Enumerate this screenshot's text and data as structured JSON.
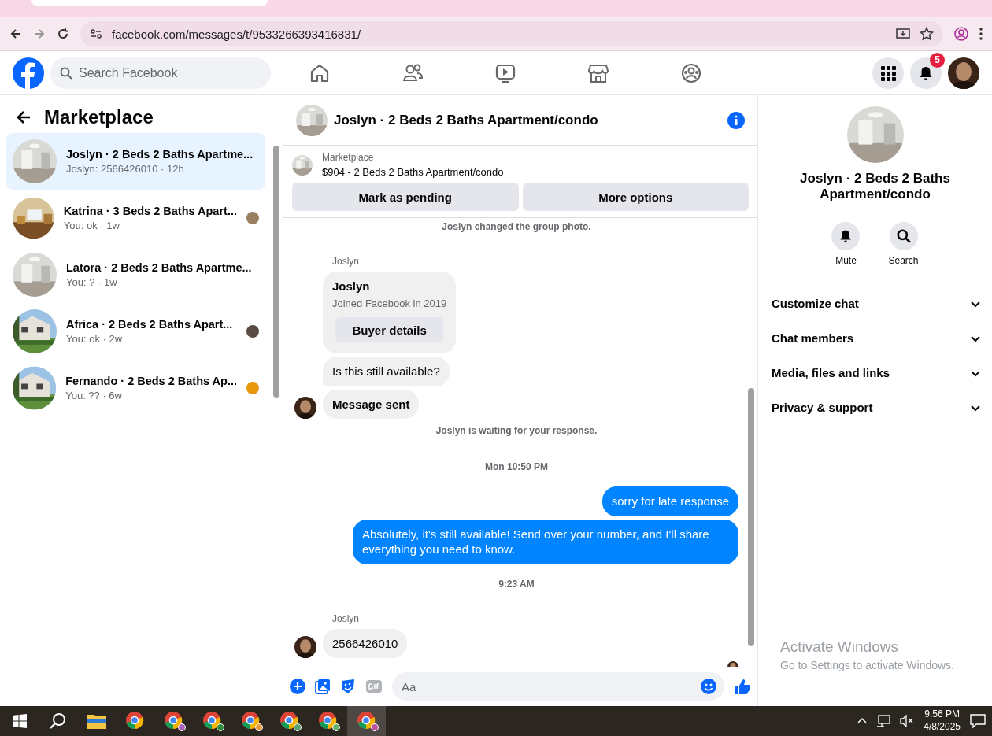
{
  "browser": {
    "url": "facebook.com/messages/t/9533266393416831/"
  },
  "header": {
    "search_placeholder": "Search Facebook",
    "nav": [
      {
        "kind": "home"
      },
      {
        "kind": "friends"
      },
      {
        "kind": "video"
      },
      {
        "kind": "store"
      },
      {
        "kind": "groups"
      }
    ],
    "notification_count": "5"
  },
  "sidebar": {
    "title": "Marketplace",
    "conversations": [
      {
        "title": "Joslyn · 2 Beds 2 Baths Apartme...",
        "preview": "Joslyn: 2566426010 · 12h",
        "selected": true,
        "kind": "room"
      },
      {
        "title": "Katrina · 3 Beds 2 Baths Apart...",
        "preview": "You: ok · 1w",
        "selected": false,
        "kind": "wood",
        "receipt": {
          "color": "#9a8060"
        }
      },
      {
        "title": "Latora · 2 Beds 2 Baths Apartme...",
        "preview": "You: ? · 1w",
        "selected": false,
        "kind": "room"
      },
      {
        "title": "Africa · 2 Beds 2 Baths Apart...",
        "preview": "You: ok · 2w",
        "selected": false,
        "kind": "house",
        "receipt": {
          "color": "#5a4a44"
        }
      },
      {
        "title": "Fernando · 2 Beds 2 Baths Ap...",
        "preview": "You: ?? · 6w",
        "selected": false,
        "kind": "house",
        "receipt": {
          "color": "#e8960c"
        }
      }
    ]
  },
  "chat": {
    "title": "Joslyn · 2 Beds 2 Baths Apartment/condo",
    "listing": {
      "label": "Marketplace",
      "text": "$904 - 2 Beds 2 Baths Apartment/condo"
    },
    "buttons": [
      "Mark as pending",
      "More options"
    ],
    "messages": [
      {
        "kind": "event",
        "text": "Joslyn changed the group photo."
      },
      {
        "kind": "sender",
        "text": "Joslyn"
      },
      {
        "kind": "card",
        "name": "Joslyn",
        "text": "Joined Facebook in 2019",
        "button": "Buyer details"
      },
      {
        "kind": "incoming",
        "text": "Is this still available?",
        "avatar": false,
        "bold": false
      },
      {
        "kind": "incoming",
        "text": "Message sent",
        "avatar": true,
        "bold": true
      },
      {
        "kind": "event",
        "text": "Joslyn is waiting for your response."
      },
      {
        "kind": "time",
        "text": "Mon 10:50 PM"
      },
      {
        "kind": "outgoing",
        "text": "sorry for late response"
      },
      {
        "kind": "outgoing",
        "text": "Absolutely, it's still available! Send over your number, and I'll share everything you need to know."
      },
      {
        "kind": "time",
        "text": "9:23 AM"
      },
      {
        "kind": "sender",
        "text": "Joslyn"
      },
      {
        "kind": "incoming",
        "text": "2566426010",
        "avatar": true,
        "bold": false
      },
      {
        "kind": "receipt"
      }
    ],
    "composer_placeholder": "Aa"
  },
  "details": {
    "title": "Joslyn · 2 Beds 2 Baths Apartment/condo",
    "actions": [
      {
        "kind": "bell",
        "label": "Mute"
      },
      {
        "kind": "search",
        "label": "Search"
      }
    ],
    "sections": [
      {
        "label": "Customize chat",
        "expanded": false
      },
      {
        "label": "Chat members",
        "expanded": false
      },
      {
        "label": "Media, files and links",
        "expanded": false
      },
      {
        "label": "Privacy & support",
        "expanded": false
      }
    ]
  },
  "activation": {
    "title": "Activate Windows",
    "text": "Go to Settings to activate Windows."
  },
  "taskbar": {
    "apps": [
      {
        "kind": "explorer",
        "selected": false
      },
      {
        "kind": "chrome",
        "selected": false
      },
      {
        "kind": "profile",
        "color": "#b060c0",
        "selected": false
      },
      {
        "kind": "profile",
        "color": "#2e8b3a",
        "selected": false
      },
      {
        "kind": "profile",
        "color": "#e89a40",
        "selected": false
      },
      {
        "kind": "profile",
        "color": "#5aa070",
        "selected": false
      },
      {
        "kind": "profile",
        "color": "#6ab070",
        "selected": false
      },
      {
        "kind": "profile",
        "color": "#c050a0",
        "selected": true
      }
    ],
    "time": "9:56 PM",
    "date": "4/8/2025"
  }
}
